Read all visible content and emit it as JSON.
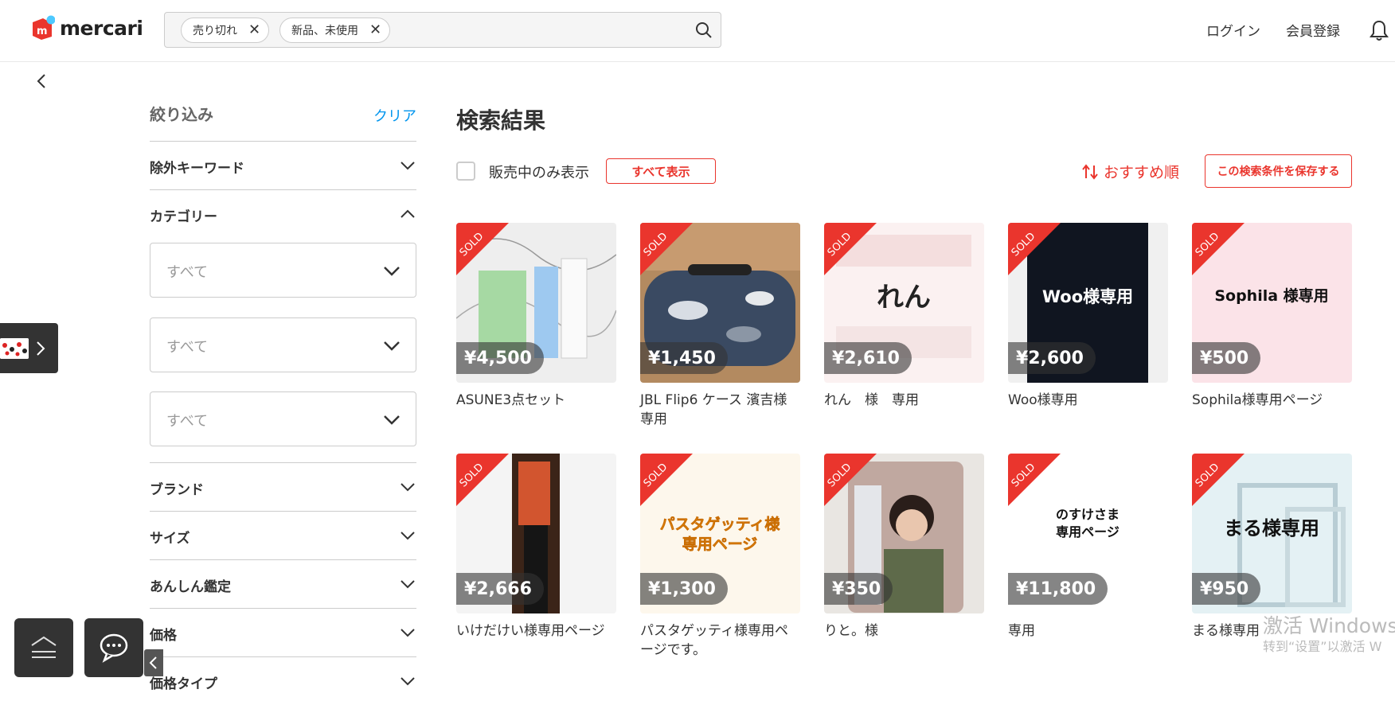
{
  "header": {
    "logo_text": "mercari",
    "search_chips": [
      {
        "label": "売り切れ"
      },
      {
        "label": "新品、未使用"
      }
    ],
    "login": "ログイン",
    "signup": "会員登録"
  },
  "sidebar": {
    "title": "絞り込み",
    "clear": "クリア",
    "sections": {
      "exclude_keyword": "除外キーワード",
      "category": "カテゴリー",
      "brand": "ブランド",
      "size": "サイズ",
      "authentication": "あんしん鑑定",
      "price": "価格",
      "price_type": "価格タイプ"
    },
    "category_selects": [
      "すべて",
      "すべて",
      "すべて"
    ]
  },
  "main": {
    "title": "検索結果",
    "on_sale_only": "販売中のみ表示",
    "show_all": "すべて表示",
    "sort": "おすすめ順",
    "save_search": "この検索条件を保存する"
  },
  "sold_badge": "SOLD",
  "items": [
    {
      "title": "ASUNE3点セット",
      "price": "¥4,500",
      "thumb_text": ""
    },
    {
      "title": "JBL Flip6 ケース 濱吉様専用",
      "price": "¥1,450",
      "thumb_text": ""
    },
    {
      "title": "れん　様　専用",
      "price": "¥2,610",
      "thumb_text": "れん"
    },
    {
      "title": "Woo様専用",
      "price": "¥2,600",
      "thumb_text": "Woo様専用"
    },
    {
      "title": "Sophila様専用ページ",
      "price": "¥500",
      "thumb_text": "Sophila 様専用"
    },
    {
      "title": "いけだけい様専用ページ",
      "price": "¥2,666",
      "thumb_text": ""
    },
    {
      "title": "パスタゲッティ様専用ページです。",
      "price": "¥1,300",
      "thumb_text": "パスタゲッティ様 専用ページ"
    },
    {
      "title": "りと。様",
      "price": "¥350",
      "thumb_text": ""
    },
    {
      "title": "専用",
      "price": "¥11,800",
      "thumb_text": "のすけさま 専用ページ"
    },
    {
      "title": "まる様専用",
      "price": "¥950",
      "thumb_text": "まる様専用"
    }
  ],
  "watermark": {
    "line1": "激活 Windows",
    "line2": "转到“设置”以激活 W"
  },
  "colors": {
    "accent_red": "#ea352d",
    "link_blue": "#0095ee",
    "dark": "#333333"
  }
}
